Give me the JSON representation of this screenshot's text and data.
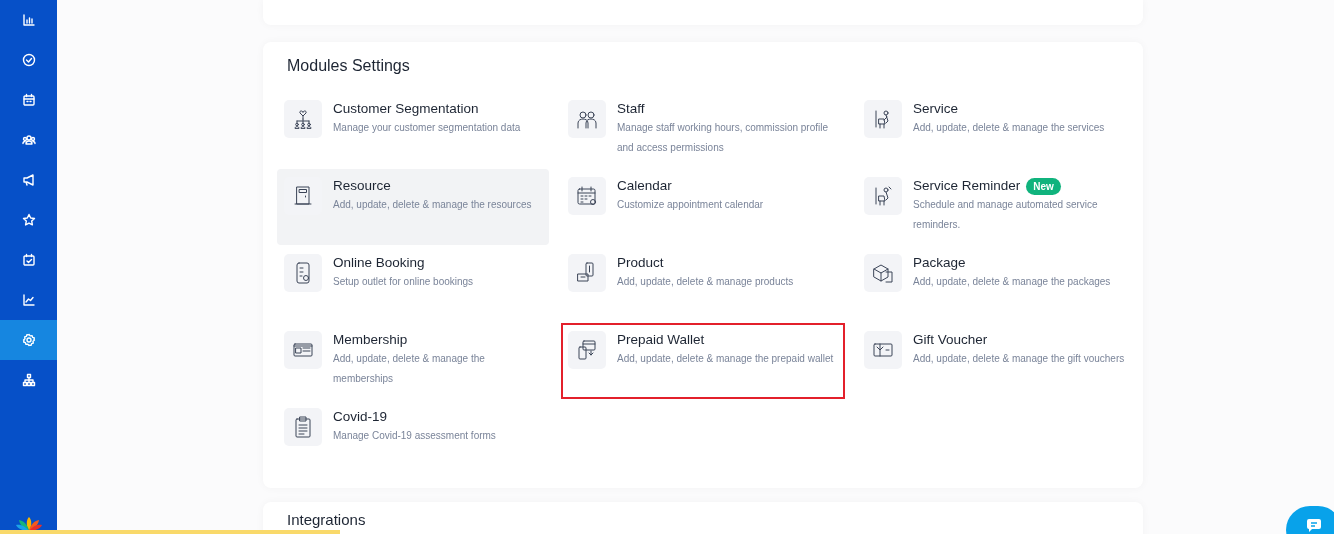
{
  "sidebar": {
    "items": [
      {
        "selected": false
      },
      {
        "selected": false
      },
      {
        "selected": false
      },
      {
        "selected": false
      },
      {
        "selected": false
      },
      {
        "selected": false
      },
      {
        "selected": false
      },
      {
        "selected": false
      },
      {
        "selected": true
      },
      {
        "selected": false
      }
    ]
  },
  "modules": {
    "title": "Modules Settings",
    "items": [
      {
        "title": "Customer Segmentation",
        "description": "Manage your customer segmentation data",
        "highlighted": false,
        "outlined": false
      },
      {
        "title": "Staff",
        "description": "Manage staff working hours, commission profile and access permissions",
        "highlighted": false,
        "outlined": false
      },
      {
        "title": "Service",
        "description": "Add, update, delete & manage the services",
        "highlighted": false,
        "outlined": false
      },
      {
        "title": "Resource",
        "description": "Add, update, delete & manage the resources",
        "highlighted": true,
        "outlined": false
      },
      {
        "title": "Calendar",
        "description": "Customize appointment calendar",
        "highlighted": false,
        "outlined": false
      },
      {
        "title": "Service Reminder",
        "badge": "New",
        "description": "Schedule and manage automated service reminders.",
        "highlighted": false,
        "outlined": false
      },
      {
        "title": "Online Booking",
        "description": "Setup outlet for online bookings",
        "highlighted": false,
        "outlined": false
      },
      {
        "title": "Product",
        "description": "Add, update, delete & manage products",
        "highlighted": false,
        "outlined": false
      },
      {
        "title": "Package",
        "description": "Add, update, delete & manage the packages",
        "highlighted": false,
        "outlined": false
      },
      {
        "title": "Membership",
        "description": "Add, update, delete & manage the memberships",
        "highlighted": false,
        "outlined": false
      },
      {
        "title": "Prepaid Wallet",
        "description": "Add, update, delete & manage the prepaid wallet",
        "highlighted": false,
        "outlined": true
      },
      {
        "title": "Gift Voucher",
        "description": "Add, update, delete & manage the gift vouchers",
        "highlighted": false,
        "outlined": false
      },
      {
        "title": "Covid-19",
        "description": "Manage Covid-19 assessment forms",
        "highlighted": false,
        "outlined": false
      }
    ]
  },
  "integrations": {
    "title": "Integrations"
  },
  "loading_bar": {
    "level": 0.255
  }
}
